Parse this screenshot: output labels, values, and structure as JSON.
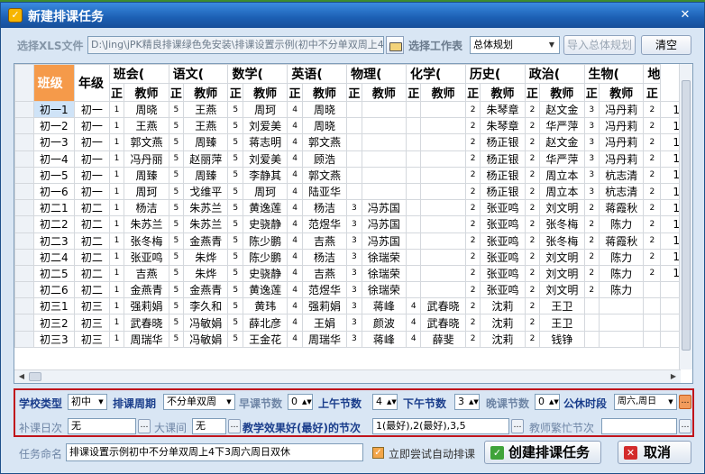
{
  "window": {
    "title": "新建排课任务",
    "close": "✕"
  },
  "file": {
    "label": "选择XLS文件",
    "path": "D:\\Jing\\jPK精良排课绿色免安装\\排课设置示例(初中不分单双周上4下3周六周日双休).xls",
    "sheet_label": "选择工作表",
    "sheet_value": "总体规划",
    "import_button": "导入总体规划",
    "clear_button": "清空"
  },
  "grid": {
    "head1": [
      "班级",
      "年级",
      "班会(",
      "语文(",
      "数学(",
      "英语(",
      "物理(",
      "化学(",
      "历史(",
      "政治(",
      "生物(",
      "地"
    ],
    "sub_z": "正",
    "sub_t": "教师",
    "rows": [
      [
        "初一1",
        "初一",
        "1",
        "周晓",
        "5",
        "王燕",
        "5",
        "周珂",
        "4",
        "周晓",
        "",
        "",
        "",
        "",
        "2",
        "朱琴章",
        "2",
        "赵文金",
        "3",
        "冯丹莉",
        "2",
        "1"
      ],
      [
        "初一2",
        "初一",
        "1",
        "王燕",
        "5",
        "王燕",
        "5",
        "刘爱美",
        "4",
        "周晓",
        "",
        "",
        "",
        "",
        "2",
        "朱琴章",
        "2",
        "华严萍",
        "3",
        "冯丹莉",
        "2",
        "1"
      ],
      [
        "初一3",
        "初一",
        "1",
        "郭文燕",
        "5",
        "周臻",
        "5",
        "蒋志明",
        "4",
        "郭文燕",
        "",
        "",
        "",
        "",
        "2",
        "杨正银",
        "2",
        "赵文金",
        "3",
        "冯丹莉",
        "2",
        "1"
      ],
      [
        "初一4",
        "初一",
        "1",
        "冯丹丽",
        "5",
        "赵丽萍",
        "5",
        "刘爱美",
        "4",
        "顾浩",
        "",
        "",
        "",
        "",
        "2",
        "杨正银",
        "2",
        "华严萍",
        "3",
        "冯丹莉",
        "2",
        "1"
      ],
      [
        "初一5",
        "初一",
        "1",
        "周臻",
        "5",
        "周臻",
        "5",
        "李静其",
        "4",
        "郭文燕",
        "",
        "",
        "",
        "",
        "2",
        "杨正银",
        "2",
        "周立本",
        "3",
        "杭志清",
        "2",
        "1"
      ],
      [
        "初一6",
        "初一",
        "1",
        "周珂",
        "5",
        "戈维平",
        "5",
        "周珂",
        "4",
        "陆亚华",
        "",
        "",
        "",
        "",
        "2",
        "杨正银",
        "2",
        "周立本",
        "3",
        "杭志清",
        "2",
        "1"
      ],
      [
        "初二1",
        "初二",
        "1",
        "杨洁",
        "5",
        "朱苏兰",
        "5",
        "黄逸莲",
        "4",
        "杨洁",
        "3",
        "冯苏国",
        "",
        "",
        "2",
        "张亚鸣",
        "2",
        "刘文明",
        "2",
        "蒋霞秋",
        "2",
        "1"
      ],
      [
        "初二2",
        "初二",
        "1",
        "朱苏兰",
        "5",
        "朱苏兰",
        "5",
        "史骁静",
        "4",
        "范煜华",
        "3",
        "冯苏国",
        "",
        "",
        "2",
        "张亚鸣",
        "2",
        "张冬梅",
        "2",
        "陈力",
        "2",
        "1"
      ],
      [
        "初二3",
        "初二",
        "1",
        "张冬梅",
        "5",
        "金燕青",
        "5",
        "陈少鹏",
        "4",
        "吉燕",
        "3",
        "冯苏国",
        "",
        "",
        "2",
        "张亚鸣",
        "2",
        "张冬梅",
        "2",
        "蒋霞秋",
        "2",
        "1"
      ],
      [
        "初二4",
        "初二",
        "1",
        "张亚鸣",
        "5",
        "朱烨",
        "5",
        "陈少鹏",
        "4",
        "杨洁",
        "3",
        "徐瑞荣",
        "",
        "",
        "2",
        "张亚鸣",
        "2",
        "刘文明",
        "2",
        "陈力",
        "2",
        "1"
      ],
      [
        "初二5",
        "初二",
        "1",
        "吉燕",
        "5",
        "朱烨",
        "5",
        "史骁静",
        "4",
        "吉燕",
        "3",
        "徐瑞荣",
        "",
        "",
        "2",
        "张亚鸣",
        "2",
        "刘文明",
        "2",
        "陈力",
        "2",
        "1"
      ],
      [
        "初二6",
        "初二",
        "1",
        "金燕青",
        "5",
        "金燕青",
        "5",
        "黄逸莲",
        "4",
        "范煜华",
        "3",
        "徐瑞荣",
        "",
        "",
        "2",
        "张亚鸣",
        "2",
        "刘文明",
        "2",
        "陈力",
        "",
        ""
      ],
      [
        "初三1",
        "初三",
        "1",
        "强莉娟",
        "5",
        "李久和",
        "5",
        "黄玮",
        "4",
        "强莉娟",
        "3",
        "蒋峰",
        "4",
        "武春晓",
        "2",
        "沈莉",
        "2",
        "王卫",
        "",
        "",
        "",
        ""
      ],
      [
        "初三2",
        "初三",
        "1",
        "武春晓",
        "5",
        "冯敏娟",
        "5",
        "薛北彦",
        "4",
        "王娟",
        "3",
        "颜波",
        "4",
        "武春晓",
        "2",
        "沈莉",
        "2",
        "王卫",
        "",
        "",
        "",
        ""
      ],
      [
        "初三3",
        "初三",
        "1",
        "周瑞华",
        "5",
        "冯敏娟",
        "5",
        "王金花",
        "4",
        "周瑞华",
        "3",
        "蒋峰",
        "4",
        "薛斐",
        "2",
        "沈莉",
        "2",
        "钱铮",
        "",
        "",
        "",
        ""
      ]
    ]
  },
  "settings": {
    "school_type_label": "学校类型",
    "school_type": "初中",
    "cycle_label": "排课周期",
    "cycle": "不分单双周",
    "early_label": "早课节数",
    "early": "0",
    "am_label": "上午节数",
    "am": "4",
    "pm_label": "下午节数",
    "pm": "3",
    "evening_label": "晚课节数",
    "evening": "0",
    "holiday_label": "公休时段",
    "holiday": "周六,周日",
    "makeup_label": "补课日次",
    "makeup": "无",
    "break_label": "大课间",
    "break": "无",
    "best_label": "教学效果好(最好)的节次",
    "best": "1(最好),2(最好),3,5",
    "teacher_busy_label": "教师繁忙节次"
  },
  "footer": {
    "name_label": "任务命名",
    "name_value": "排课设置示例初中不分单双周上4下3周六周日双休",
    "auto_label": "立即尝试自动排课",
    "create_button": "创建排课任务",
    "cancel_button": "取消"
  },
  "colors": {
    "accent_orange": "#f59a4a",
    "frame_red": "#c0141b",
    "title_blue": "#1c5fb3"
  }
}
